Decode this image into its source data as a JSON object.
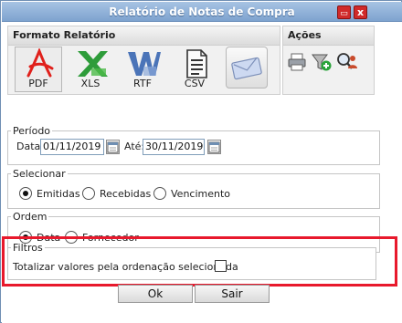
{
  "window": {
    "title": "Relatório de Notas de Compra",
    "minimize_glyph": "▭",
    "close_glyph": "x"
  },
  "formato": {
    "header": "Formato Relatório",
    "items": [
      {
        "label": "PDF",
        "icon": "pdf-icon",
        "selected": true
      },
      {
        "label": "XLS",
        "icon": "excel-icon",
        "selected": false
      },
      {
        "label": "RTF",
        "icon": "word-icon",
        "selected": false
      },
      {
        "label": "CSV",
        "icon": "csv-document-icon",
        "selected": false
      },
      {
        "label": "",
        "icon": "email-icon",
        "selected": false
      }
    ]
  },
  "acoes": {
    "header": "Ações",
    "icons": [
      "printer-icon",
      "filter-add-icon",
      "search-user-icon"
    ]
  },
  "periodo": {
    "legend": "Período",
    "data_label": "Data:",
    "data_value": "01/11/2019",
    "ate_label": "Até:",
    "ate_value": "30/11/2019"
  },
  "selecionar": {
    "legend": "Selecionar",
    "options": [
      "Emitidas",
      "Recebidas",
      "Vencimento"
    ],
    "selected": "Emitidas"
  },
  "ordem": {
    "legend": "Ordem",
    "options": [
      "Data",
      "Fornecedor"
    ],
    "selected": "Data"
  },
  "filtros": {
    "legend": "Filtros",
    "totalizar_label": "Totalizar valores pela ordenação selecionada",
    "checked": false
  },
  "buttons": {
    "ok": "Ok",
    "sair": "Sair"
  },
  "colors": {
    "highlight": "#e8192c",
    "title_bar": "#8fb0d9"
  }
}
